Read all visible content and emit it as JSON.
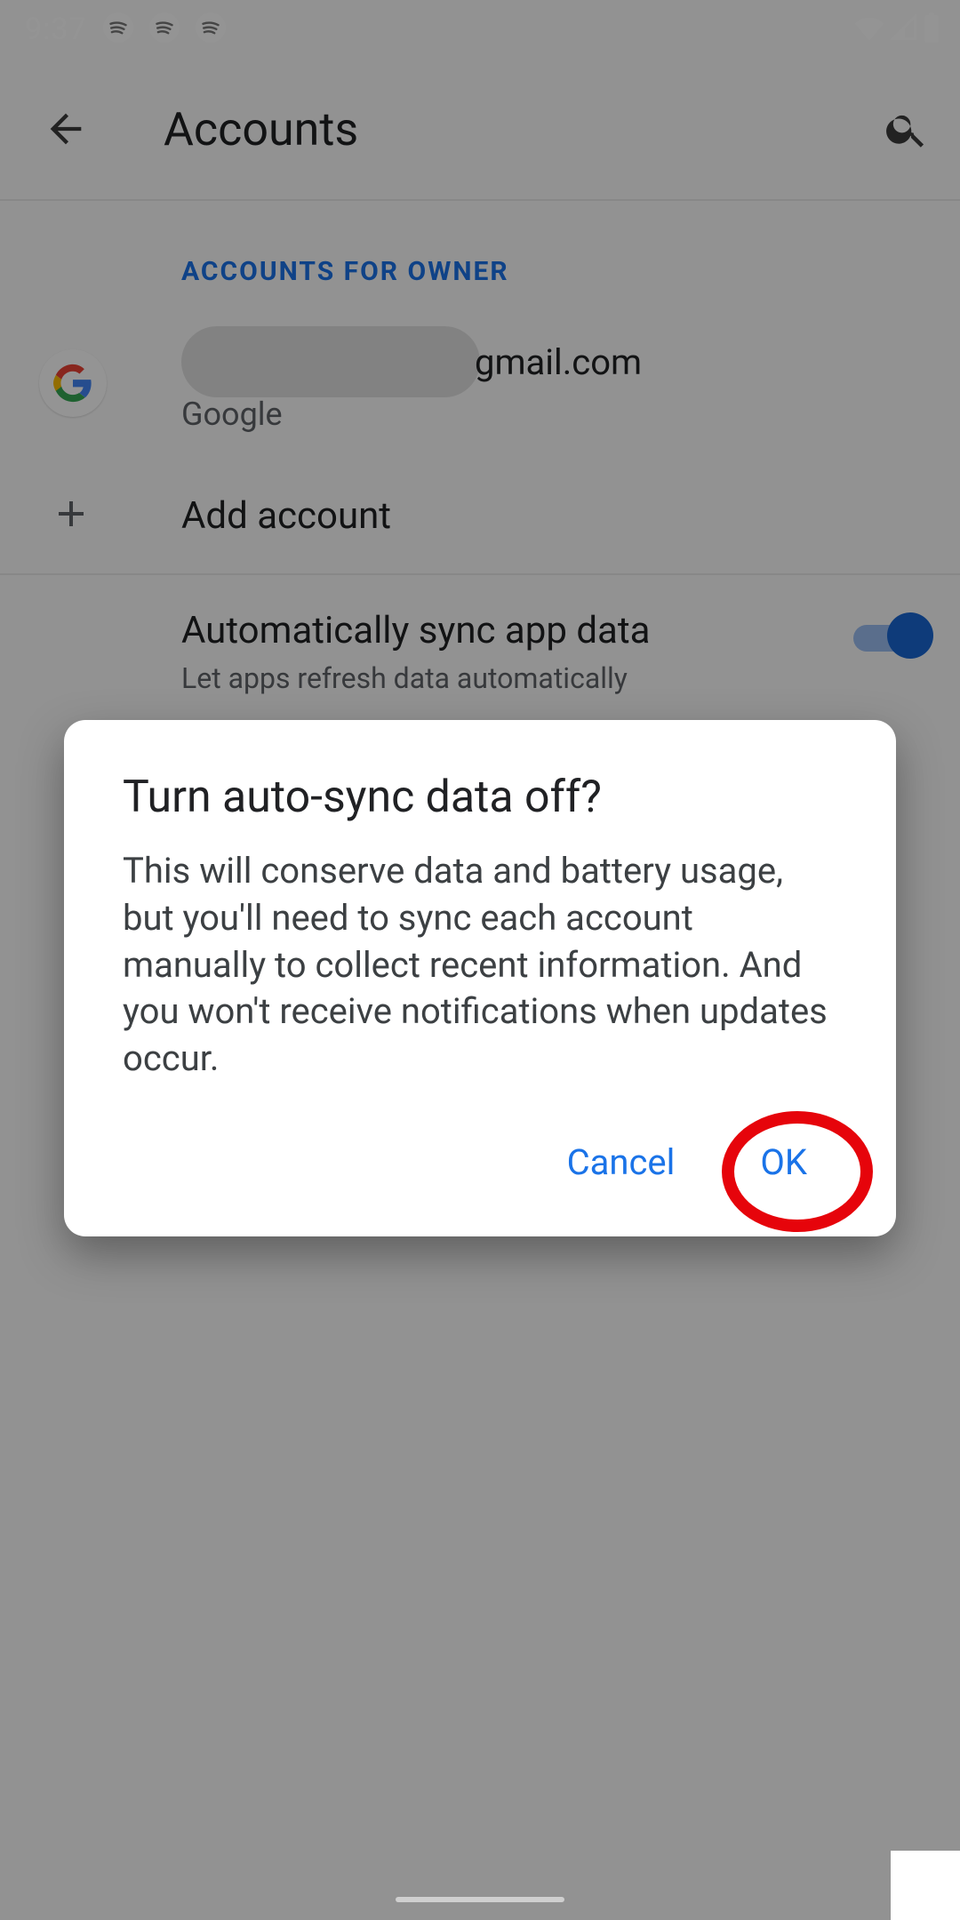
{
  "status": {
    "time": "9:37"
  },
  "appbar": {
    "title": "Accounts"
  },
  "section_header": "ACCOUNTS FOR OWNER",
  "account": {
    "email_suffix": "gmail.com",
    "provider": "Google"
  },
  "add_account_label": "Add account",
  "sync": {
    "title": "Automatically sync app data",
    "subtitle": "Let apps refresh data automatically",
    "enabled": true
  },
  "dialog": {
    "title": "Turn auto-sync data off?",
    "body": "This will conserve data and battery usage, but you'll need to sync each account manually to collect recent information. And you won't receive notifications when updates occur.",
    "cancel": "Cancel",
    "ok": "OK"
  },
  "colors": {
    "accent": "#1a73e8",
    "highlight": "#e6040b"
  }
}
